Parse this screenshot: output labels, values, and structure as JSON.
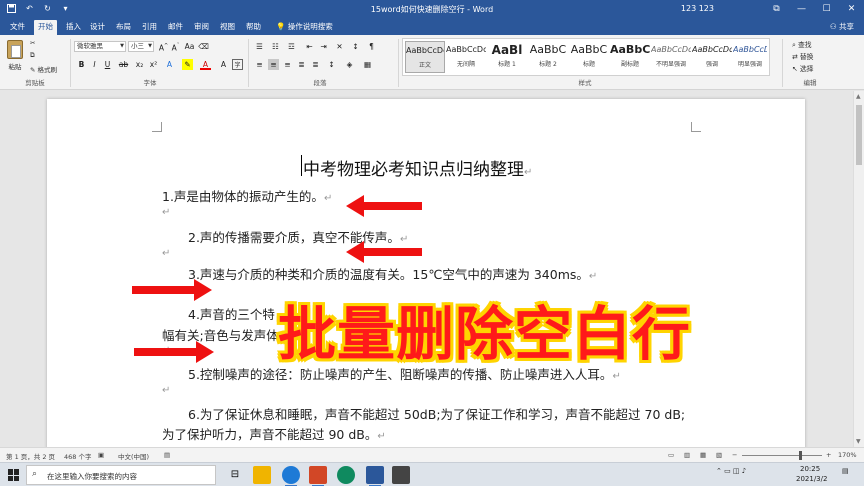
{
  "titlebar": {
    "document_title": "15word如何快速删除空行 - Word",
    "user": "123 123",
    "restore_glyph": "⧉",
    "minimize_glyph": "—",
    "maximize_glyph": "☐",
    "close_glyph": "✕"
  },
  "tabs": {
    "items": [
      "文件",
      "开始",
      "插入",
      "设计",
      "布局",
      "引用",
      "邮件",
      "审阅",
      "视图",
      "帮助",
      "操作说明搜索"
    ],
    "share": "共享"
  },
  "ribbon": {
    "paste_label": "粘贴",
    "cut_label": "剪切",
    "copy_label": "复制",
    "format_painter_label": "格式刷",
    "clipboard_group": "剪贴板",
    "font_name": "微软雅黑",
    "font_size": "小三",
    "font_group": "字体",
    "paragraph_group": "段落",
    "styles_group": "样式",
    "editing_group": "编辑",
    "find_label": "查找",
    "replace_label": "替换",
    "select_label": "选择",
    "styles": [
      {
        "sample": "AaBbCcDc",
        "name": "正文"
      },
      {
        "sample": "AaBbCcDc",
        "name": "无间隔"
      },
      {
        "sample": "AaBl",
        "name": "标题 1"
      },
      {
        "sample": "AaBbC",
        "name": "标题 2"
      },
      {
        "sample": "AaBbC",
        "name": "标题"
      },
      {
        "sample": "AaBbC",
        "name": "副标题"
      },
      {
        "sample": "AaBbCcDc",
        "name": "不明显强调"
      },
      {
        "sample": "AaBbCcDc",
        "name": "强调"
      },
      {
        "sample": "AaBbCcDc",
        "name": "明显强调"
      }
    ]
  },
  "document": {
    "title": "中考物理必考知识点归纳整理",
    "para_mark": "↵",
    "lines": [
      "1.声是由物体的振动产生的。",
      "2.声的传播需要介质，真空不能传声。",
      "3.声速与介质的种类和介质的温度有关。15℃空气中的声速为 340ms。",
      "4.声音的三个特",
      "幅有关;音色与发声体",
      "5.控制噪声的途径：防止噪声的产生、阻断噪声的传播、防止噪声进入人耳。",
      "6.为了保证休息和睡眠，声音不能超过 50dB;为了保证工作和学习，声音不能超过 70 dB;",
      "为了保护听力，声音不能超过 90 dB。"
    ],
    "overlay": "批量删除空白行"
  },
  "statusbar": {
    "page": "第 1 页，共 2 页",
    "words": "468 个字",
    "language": "中文(中国)",
    "zoom": "170%"
  },
  "taskbar": {
    "search_placeholder": "在这里输入你要搜索的内容",
    "time": "20:25",
    "date": "2021/3/2"
  },
  "colors": {
    "word_blue": "#2b579a",
    "overlay_red": "#ff1a1a",
    "overlay_outline": "#ffd400",
    "arrow_red": "#ee1111"
  }
}
